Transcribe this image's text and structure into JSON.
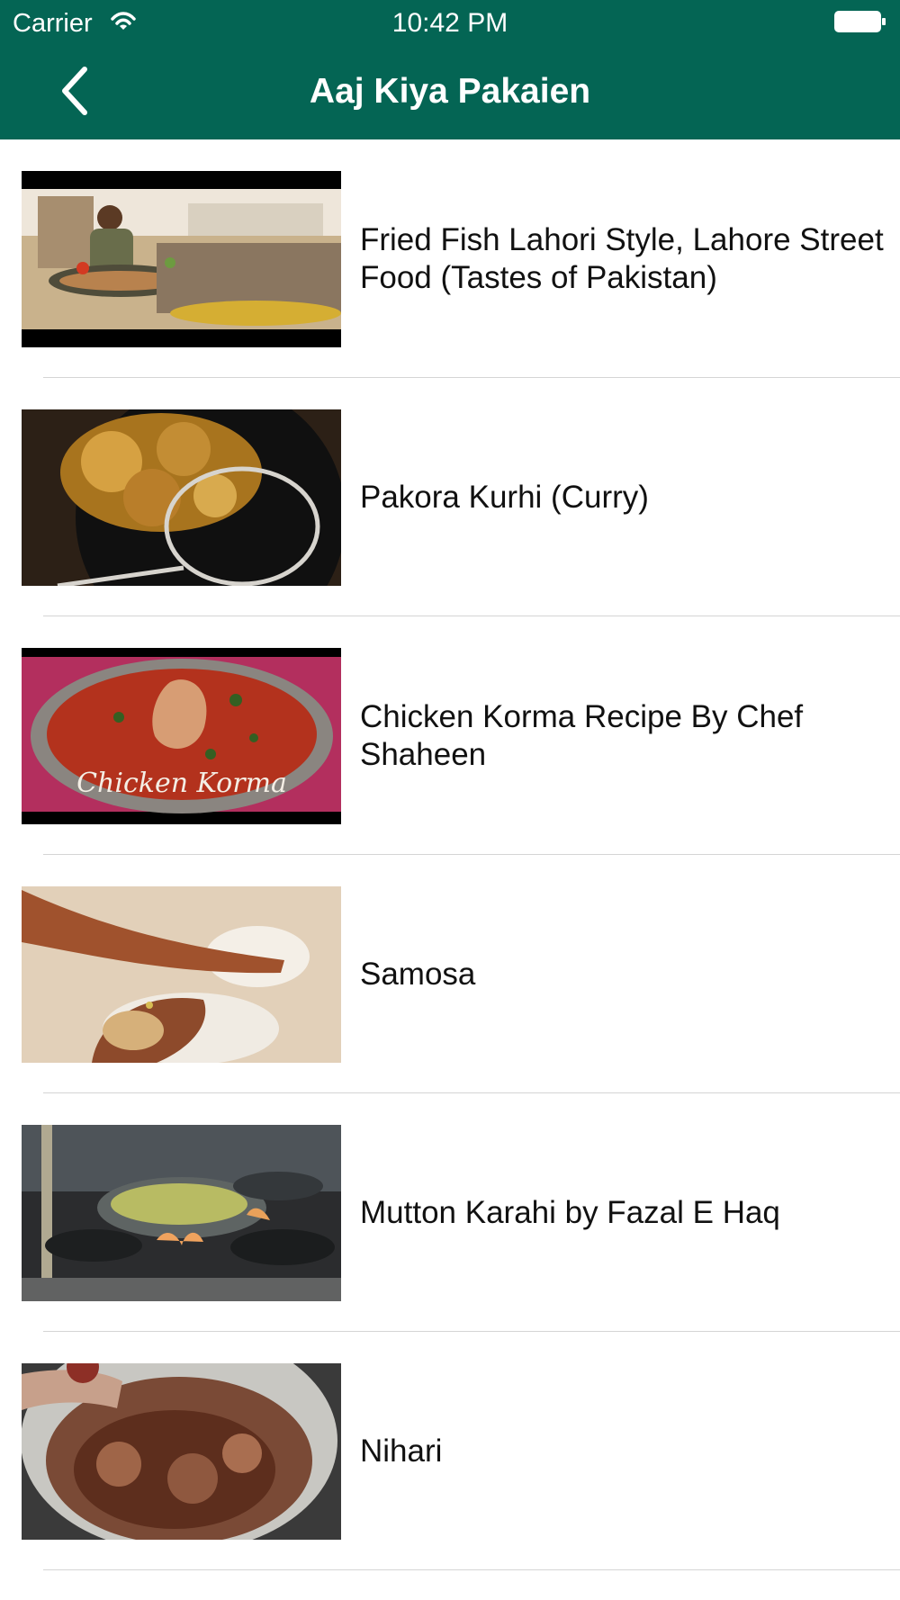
{
  "status_bar": {
    "carrier": "Carrier",
    "time": "10:42 PM",
    "wifi_icon": "wifi-icon",
    "battery_icon": "battery-icon"
  },
  "nav": {
    "title": "Aaj Kiya Pakaien",
    "back_icon": "chevron-left-icon"
  },
  "colors": {
    "header_background": "#046554",
    "header_text": "#ffffff",
    "row_text": "#111111",
    "divider": "#d5d5d5"
  },
  "videos": [
    {
      "title": "Fried Fish Lahori Style, Lahore Street Food (Tastes of Pakistan)",
      "thumbnail_text": ""
    },
    {
      "title": "Pakora Kurhi (Curry)",
      "thumbnail_text": ""
    },
    {
      "title": "Chicken Korma Recipe By Chef Shaheen",
      "thumbnail_text": "Chicken Korma"
    },
    {
      "title": "Samosa",
      "thumbnail_text": ""
    },
    {
      "title": "Mutton Karahi by Fazal E Haq",
      "thumbnail_text": ""
    },
    {
      "title": "Nihari",
      "thumbnail_text": ""
    }
  ]
}
